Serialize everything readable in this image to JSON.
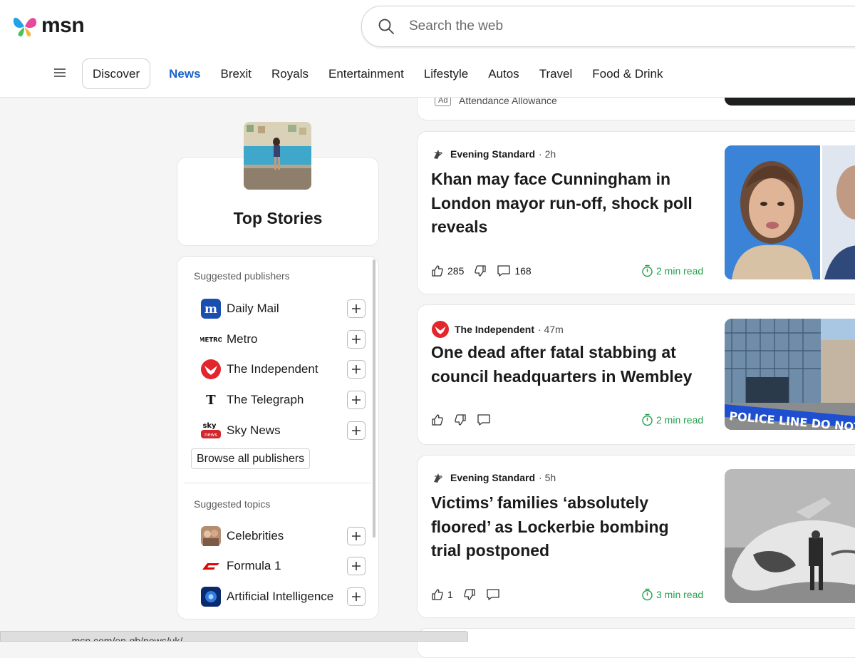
{
  "header": {
    "logo_text": "msn",
    "search_placeholder": "Search the web",
    "discover_label": "Discover",
    "nav": [
      "News",
      "Brexit",
      "Royals",
      "Entertainment",
      "Lifestyle",
      "Autos",
      "Travel",
      "Food & Drink"
    ]
  },
  "sidebar": {
    "top_stories_title": "Top Stories",
    "publishers_title": "Suggested publishers",
    "publishers": [
      "Daily Mail",
      "Metro",
      "The Independent",
      "The Telegraph",
      "Sky News"
    ],
    "browse_label": "Browse all publishers",
    "topics_title": "Suggested topics",
    "topics": [
      "Celebrities",
      "Formula 1",
      "Artificial Intelligence"
    ]
  },
  "ad": {
    "badge": "Ad",
    "text": "Attendance Allowance"
  },
  "articles": [
    {
      "source": "Evening Standard",
      "time": "· 2h",
      "title": "Khan may face Cunningham in London mayor run-off, shock poll reveals",
      "likes": "285",
      "comments": "168",
      "read_time": "2 min read"
    },
    {
      "source": "The Independent",
      "time": "· 47m",
      "title": "One dead after fatal stabbing at council headquarters in Wembley",
      "likes": "",
      "comments": "",
      "read_time": "2 min read",
      "image_text": "POLICE LINE DO NOT CR"
    },
    {
      "source": "Evening Standard",
      "time": "· 5h",
      "title": "Victims’ families ‘absolutely floored’ as Lockerbie bombing trial postponed",
      "likes": "1",
      "comments": "",
      "read_time": "3 min read"
    }
  ],
  "status_bar": "...msn.com/en-gb/news/uk/...",
  "colors": {
    "accent": "#1b62c9",
    "read_time": "#22a04b",
    "independent_red": "#e2262b",
    "daily_mail_blue": "#1a4fb0"
  }
}
